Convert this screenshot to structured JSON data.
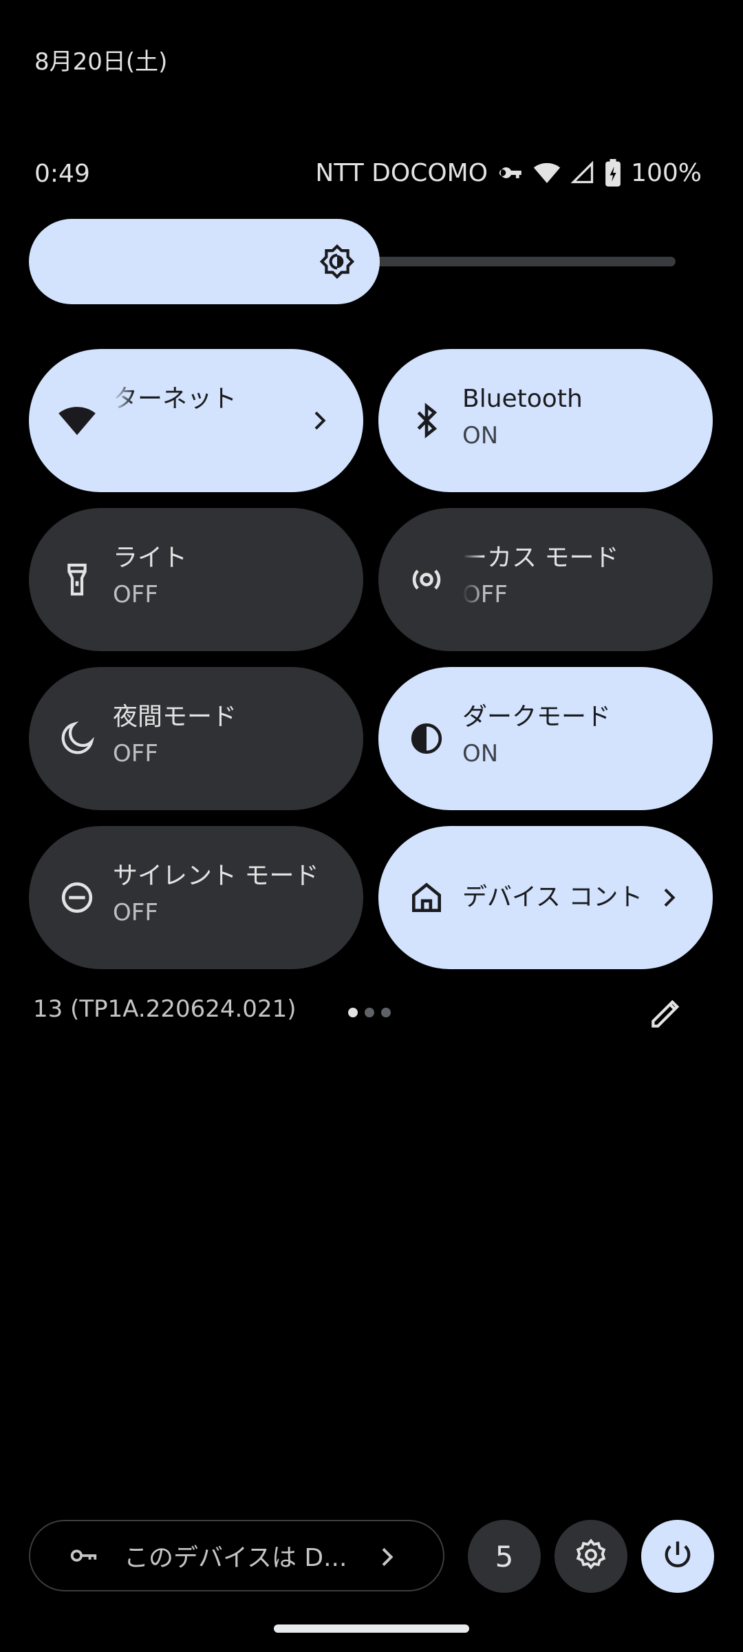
{
  "header": {
    "date": "8月20日(土)",
    "time": "0:49",
    "carrier": "NTT DOCOMO",
    "battery": "100%",
    "icons": [
      "vpn-key-icon",
      "wifi-icon",
      "signal-icon",
      "battery-charging-icon"
    ]
  },
  "brightness": {
    "level": 0.5,
    "icon": "brightness-icon"
  },
  "tiles": [
    {
      "label": "ターネット",
      "state": "",
      "active": true,
      "icon": "wifi-icon",
      "chevron": true
    },
    {
      "label": "Bluetooth",
      "state": "ON",
      "active": true,
      "icon": "bluetooth-icon"
    },
    {
      "label": "ライト",
      "state": "OFF",
      "active": false,
      "icon": "flashlight-icon"
    },
    {
      "label": "ーカス モード",
      "state": "OFF",
      "active": false,
      "icon": "focus-mode-icon"
    },
    {
      "label": "夜間モード",
      "state": "OFF",
      "active": false,
      "icon": "moon-icon"
    },
    {
      "label": "ダークモード",
      "state": "ON",
      "active": true,
      "icon": "dark-mode-icon"
    },
    {
      "label": "サイレント モード",
      "state": "OFF",
      "active": false,
      "icon": "do-not-disturb-icon"
    },
    {
      "label": "デバイス コント",
      "state": "",
      "active": true,
      "icon": "home-icon",
      "chevron": true
    }
  ],
  "footer": {
    "build": "13 (TP1A.220624.021)",
    "pages": 3,
    "current_page": 1
  },
  "bottom_bar": {
    "vpn_text": "このデバイスは D...",
    "notification_count": "5"
  },
  "colors": {
    "background": "#000000",
    "tile_on": "#d3e3fd",
    "tile_off": "#303134"
  }
}
